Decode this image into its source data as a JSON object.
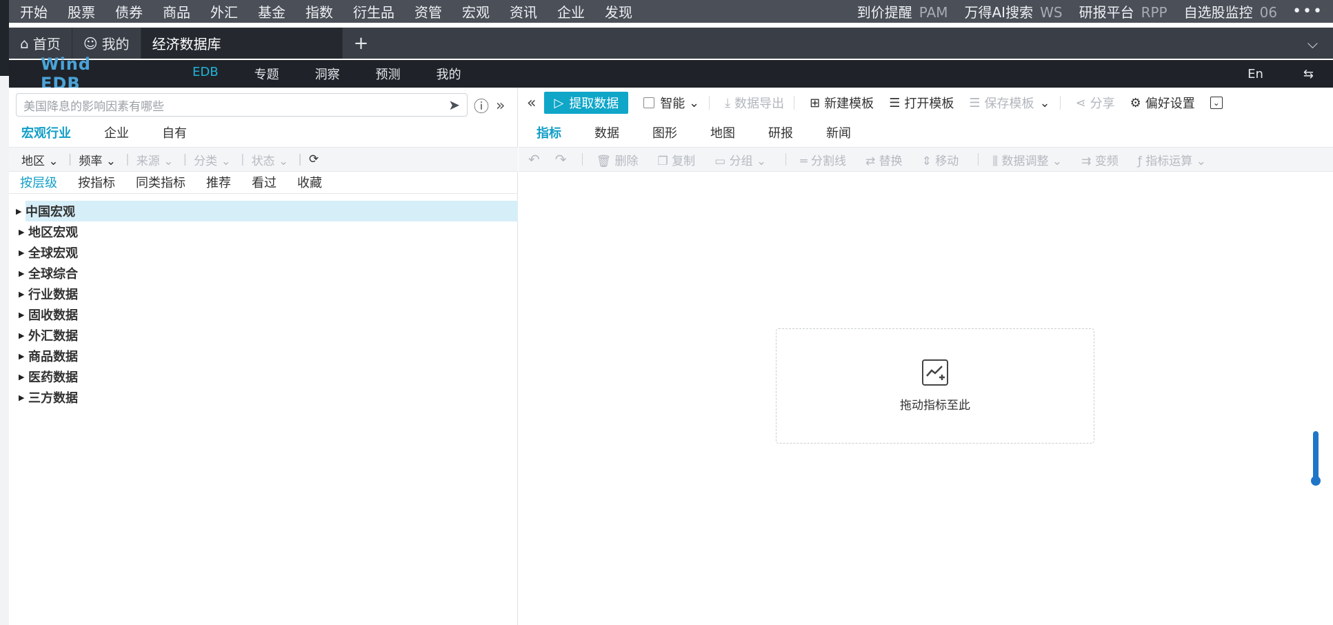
{
  "topmenu": {
    "items": [
      "开始",
      "股票",
      "债券",
      "商品",
      "外汇",
      "基金",
      "指数",
      "衍生品",
      "资管",
      "宏观",
      "资讯",
      "企业",
      "发现"
    ],
    "right": [
      {
        "label": "到价提醒",
        "sub": "PAM"
      },
      {
        "label": "万得AI搜索",
        "sub": "WS"
      },
      {
        "label": "研报平台",
        "sub": "RPP"
      },
      {
        "label": "自选股监控",
        "sub": "06"
      }
    ],
    "more": "•••"
  },
  "tabs": {
    "home": "首页",
    "mine": "我的",
    "active": "经济数据库",
    "add": "+",
    "dropdown": "⌵"
  },
  "prodnav": {
    "logo": "Wind EDB",
    "items": [
      "EDB",
      "专题",
      "洞察",
      "预测",
      "我的"
    ],
    "lang": "En",
    "switch": "⇆"
  },
  "left": {
    "search_placeholder": "美国降息的影响因素有哪些",
    "scope": [
      "宏观行业",
      "企业",
      "自有"
    ],
    "filters": {
      "region": "地区",
      "frequency": "频率",
      "source": "来源",
      "category": "分类",
      "status": "状态"
    },
    "subtabs": [
      "按层级",
      "按指标",
      "同类指标",
      "推荐",
      "看过",
      "收藏"
    ],
    "tree": [
      "中国宏观",
      "地区宏观",
      "全球宏观",
      "全球综合",
      "行业数据",
      "固收数据",
      "外汇数据",
      "商品数据",
      "医药数据",
      "三方数据"
    ]
  },
  "right": {
    "extract": "提取数据",
    "smart": "智能",
    "export": "数据导出",
    "new_template": "新建模板",
    "open_template": "打开模板",
    "save_template": "保存模板",
    "share": "分享",
    "preferences": "偏好设置",
    "viewtabs": [
      "指标",
      "数据",
      "图形",
      "地图",
      "研报",
      "新闻"
    ],
    "actions": {
      "delete": "删除",
      "copy": "复制",
      "group": "分组",
      "divider": "分割线",
      "replace": "替换",
      "move": "移动",
      "adjust": "数据调整",
      "transform": "变频",
      "calc": "指标运算"
    },
    "dropzone_text": "拖动指标至此"
  }
}
